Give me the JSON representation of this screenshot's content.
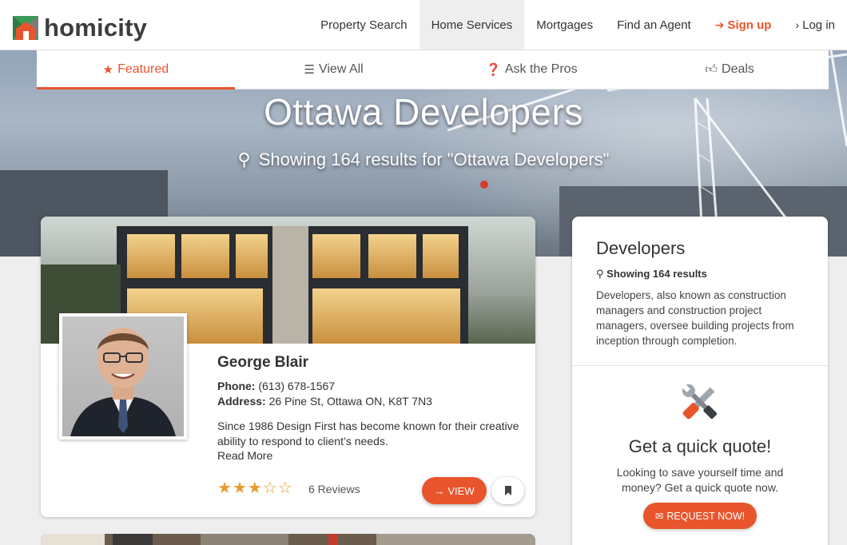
{
  "brand": {
    "name": "homicity",
    "accent": "#e8552d"
  },
  "nav": {
    "items": [
      {
        "label": "Property Search"
      },
      {
        "label": "Home Services",
        "active": true
      },
      {
        "label": "Mortgages"
      },
      {
        "label": "Find an Agent"
      }
    ],
    "signup": "Sign up",
    "login": "Log in"
  },
  "subtabs": [
    {
      "label": "Featured",
      "icon": "star-icon",
      "active": true
    },
    {
      "label": "View All",
      "icon": "list-icon"
    },
    {
      "label": "Ask the Pros",
      "icon": "question-circle-icon"
    },
    {
      "label": "Deals",
      "icon": "thumbs-up-icon"
    }
  ],
  "hero": {
    "title": "Ottawa Developers",
    "subtitle": "Showing 164 results for \"Ottawa Developers\""
  },
  "listing": {
    "name": "George Blair",
    "phone_label": "Phone:",
    "phone": "(613) 678-1567",
    "address_label": "Address:",
    "address": "26 Pine St, Ottawa ON, K8T 7N3",
    "description": "Since 1986 Design First has become known for their creative ability to respond to client’s needs.",
    "read_more": "Read More",
    "rating": 3,
    "rating_max": 5,
    "reviews": "6 Reviews",
    "view_label": "VIEW"
  },
  "sidebar": {
    "title": "Developers",
    "count": "Showing 164 results",
    "description": "Developers, also known as construction managers and construction project managers, oversee building projects from inception through completion.",
    "quote_title": "Get a quick quote!",
    "quote_desc": "Looking to save yourself time and money? Get a quick quote now.",
    "request_label": "REQUEST NOW!"
  }
}
